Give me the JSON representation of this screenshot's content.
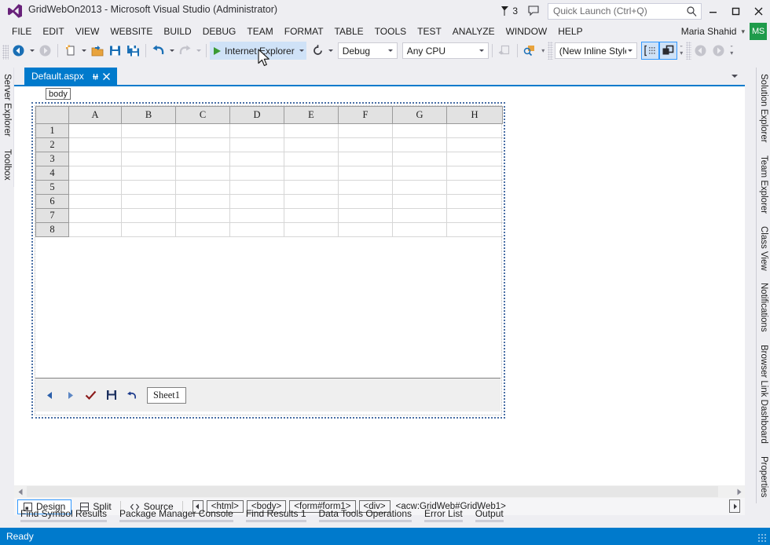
{
  "window": {
    "title": "GridWebOn2013 - Microsoft Visual Studio (Administrator)",
    "logo_name": "visual-studio-logo",
    "notification_count": "3",
    "minimize_label": "–",
    "maximize_label": "□",
    "close_label": "✕"
  },
  "quick_launch": {
    "placeholder": "Quick Launch (Ctrl+Q)",
    "value": ""
  },
  "menu": {
    "items": [
      "FILE",
      "EDIT",
      "VIEW",
      "WEBSITE",
      "BUILD",
      "DEBUG",
      "TEAM",
      "FORMAT",
      "TABLE",
      "TOOLS",
      "TEST",
      "ANALYZE",
      "WINDOW",
      "HELP"
    ]
  },
  "account": {
    "name": "Maria Shahid",
    "initials": "MS",
    "avatar_color": "#1f9b4b"
  },
  "toolbar": {
    "navigate_back": "Navigate Backward",
    "navigate_forward": "Navigate Forward",
    "new_item": "New Item",
    "open_file": "Open File",
    "save": "Save",
    "save_all": "Save All",
    "undo": "Undo",
    "redo": "Redo",
    "run_label": "Internet Explorer",
    "refresh": "Refresh",
    "configuration": "Debug",
    "platform": "Any CPU",
    "style_application": "(New Inline Style)",
    "accent_run_bg": "#cfe2f7",
    "accent_toggle_border": "#3399ff"
  },
  "dock_left": {
    "tabs": [
      "Server Explorer",
      "Toolbox"
    ]
  },
  "dock_right": {
    "tabs": [
      "Solution Explorer",
      "Team Explorer",
      "Class View",
      "Notifications",
      "Browser Link Dashboard",
      "Properties"
    ]
  },
  "document": {
    "tab_name": "Default.aspx",
    "tab_color": "#007acc",
    "pin_glyph": "⚐",
    "close_glyph": "✕",
    "tag_breadcrumb": "body"
  },
  "gridweb": {
    "selection_color": "#4a6fa5",
    "columns": [
      "A",
      "B",
      "C",
      "D",
      "E",
      "F",
      "G",
      "H"
    ],
    "rows": [
      "1",
      "2",
      "3",
      "4",
      "5",
      "6",
      "7",
      "8"
    ],
    "cells": [
      [
        "",
        "",
        "",
        "",
        "",
        "",
        "",
        ""
      ],
      [
        "",
        "",
        "",
        "",
        "",
        "",
        "",
        ""
      ],
      [
        "",
        "",
        "",
        "",
        "",
        "",
        "",
        ""
      ],
      [
        "",
        "",
        "",
        "",
        "",
        "",
        "",
        ""
      ],
      [
        "",
        "",
        "",
        "",
        "",
        "",
        "",
        ""
      ],
      [
        "",
        "",
        "",
        "",
        "",
        "",
        "",
        ""
      ],
      [
        "",
        "",
        "",
        "",
        "",
        "",
        "",
        ""
      ],
      [
        "",
        "",
        "",
        "",
        "",
        "",
        "",
        ""
      ]
    ],
    "sheet_tab": "Sheet1",
    "toolbar_buttons": [
      "prev-sheet",
      "next-sheet",
      "submit",
      "save",
      "undo"
    ]
  },
  "view_bar": {
    "design_label": "Design",
    "split_label": "Split",
    "source_label": "Source",
    "active_view": "Design",
    "breadcrumbs": [
      "<html>",
      "<body>",
      "<form#form1>",
      "<div>",
      "<acw:GridWeb#GridWeb1>"
    ],
    "current_breadcrumb": "<acw:GridWeb#GridWeb1>"
  },
  "panel_tabs": [
    "Find Symbol Results",
    "Package Manager Console",
    "Find Results 1",
    "Data Tools Operations",
    "Error List",
    "Output"
  ],
  "status_bar": {
    "text": "Ready",
    "background": "#007acc"
  }
}
